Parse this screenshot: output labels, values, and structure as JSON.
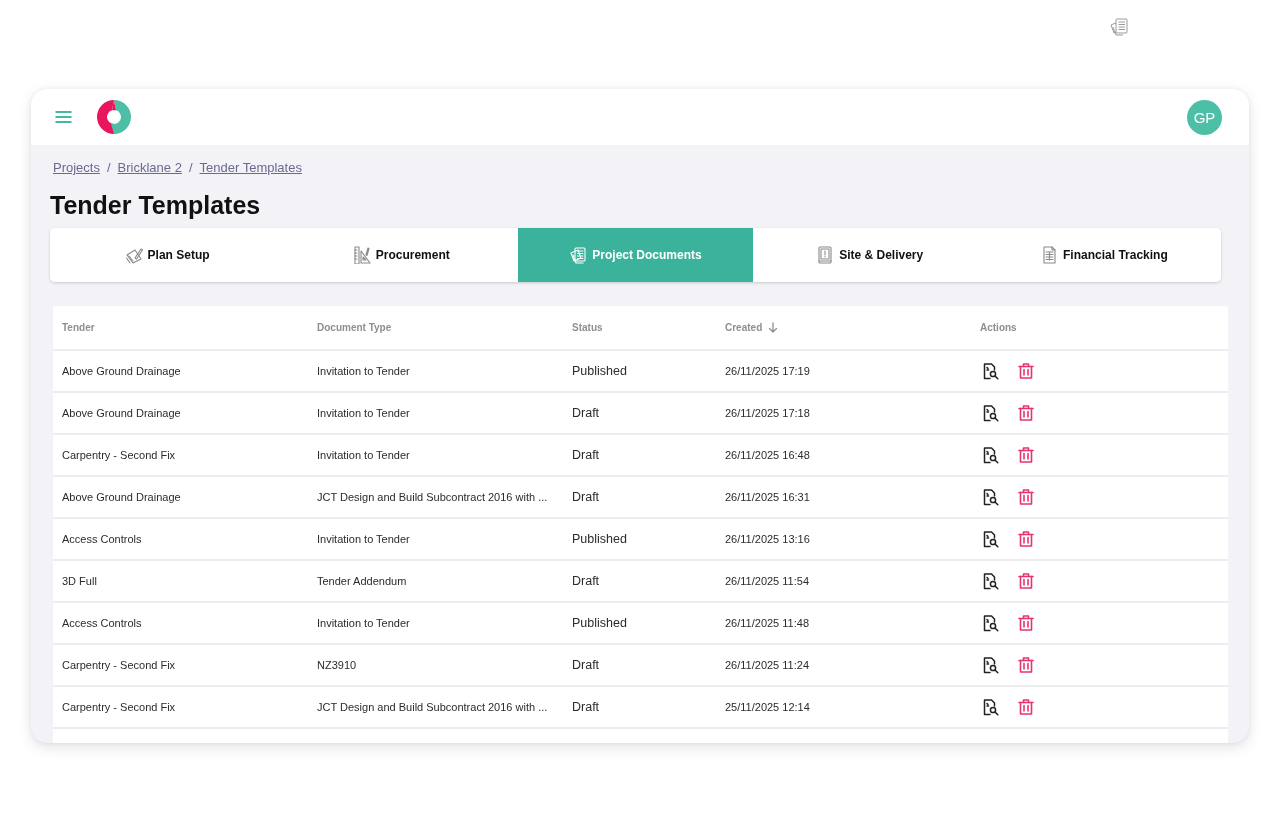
{
  "header": {
    "avatar_initials": "GP"
  },
  "breadcrumb": [
    {
      "label": "Projects",
      "separator": "/"
    },
    {
      "label": "Bricklane 2",
      "separator": "/"
    },
    {
      "label": "Tender Templates"
    }
  ],
  "page_title": "Tender Templates",
  "tabs": [
    {
      "label": "Plan Setup",
      "selected": false
    },
    {
      "label": "Procurement",
      "selected": false
    },
    {
      "label": "Project Documents",
      "selected": true
    },
    {
      "label": "Site & Delivery",
      "selected": false
    },
    {
      "label": "Financial Tracking",
      "selected": false
    }
  ],
  "table": {
    "columns": [
      {
        "label": "Tender",
        "sorted": false
      },
      {
        "label": "Document Type",
        "sorted": false
      },
      {
        "label": "Status",
        "sorted": false
      },
      {
        "label": "Created",
        "sorted": true,
        "descending": true
      },
      {
        "label": "Actions",
        "sorted": false
      }
    ],
    "rows": [
      {
        "tender": "Above Ground Drainage",
        "document_type": "Invitation to Tender",
        "status": "Published",
        "created": "26/11/2025 17:19"
      },
      {
        "tender": "Above Ground Drainage",
        "document_type": "Invitation to Tender",
        "status": "Draft",
        "created": "26/11/2025 17:18"
      },
      {
        "tender": "Carpentry - Second Fix",
        "document_type": "Invitation to Tender",
        "status": "Draft",
        "created": "26/11/2025 16:48"
      },
      {
        "tender": "Above Ground Drainage",
        "document_type": "JCT Design and Build Subcontract 2016 with ...",
        "status": "Draft",
        "created": "26/11/2025 16:31"
      },
      {
        "tender": "Access Controls",
        "document_type": "Invitation to Tender",
        "status": "Published",
        "created": "26/11/2025 13:16"
      },
      {
        "tender": "3D Full",
        "document_type": "Tender Addendum",
        "status": "Draft",
        "created": "26/11/2025 11:54"
      },
      {
        "tender": "Access Controls",
        "document_type": "Invitation to Tender",
        "status": "Published",
        "created": "26/11/2025 11:48"
      },
      {
        "tender": "Carpentry - Second Fix",
        "document_type": "NZ3910",
        "status": "Draft",
        "created": "26/11/2025 11:24"
      },
      {
        "tender": "Carpentry - Second Fix",
        "document_type": "JCT Design and Build Subcontract 2016 with ...",
        "status": "Draft",
        "created": "25/11/2025 12:14"
      }
    ]
  }
}
